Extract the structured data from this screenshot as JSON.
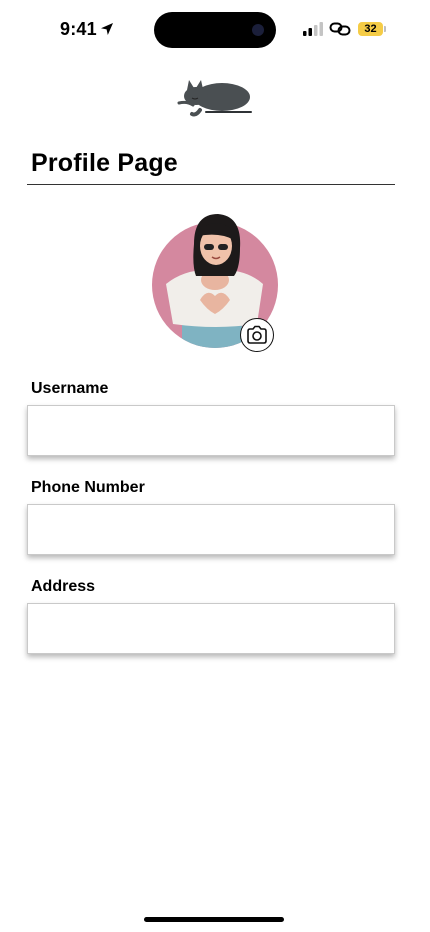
{
  "status_bar": {
    "time": "9:41",
    "battery": "32",
    "icons": [
      "location-arrow-icon",
      "cellular-signal-icon",
      "link-icon",
      "battery-icon"
    ]
  },
  "header": {
    "logo": "sleeping-cat-logo",
    "title": "Profile Page"
  },
  "avatar": {
    "image": "woman-heart-hands-avatar",
    "edit_icon": "camera-icon"
  },
  "form": {
    "username": {
      "label": "Username",
      "value": "",
      "placeholder": ""
    },
    "phone": {
      "label": "Phone Number",
      "value": "",
      "placeholder": ""
    },
    "address": {
      "label": "Address",
      "value": "",
      "placeholder": ""
    }
  },
  "colors": {
    "avatar_bg": "#d4889f",
    "battery": "#f5cc46",
    "input_border": "#c9c9c9"
  }
}
